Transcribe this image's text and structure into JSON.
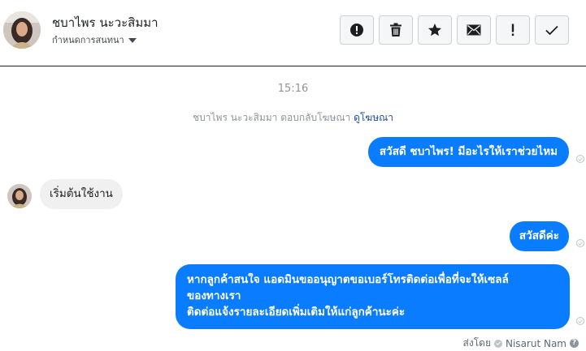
{
  "header": {
    "contact_name": "ชบาไพร นะวะสิมมา",
    "subtitle": "กำหนดการสนทนา",
    "actions": [
      {
        "icon": "alert-circle-icon",
        "label": "report"
      },
      {
        "icon": "trash-icon",
        "label": "delete"
      },
      {
        "icon": "star-icon",
        "label": "star"
      },
      {
        "icon": "envelope-icon",
        "label": "mark unread"
      },
      {
        "icon": "exclamation-icon",
        "label": "spam"
      },
      {
        "icon": "checkmark-icon",
        "label": "done"
      }
    ]
  },
  "conversation": {
    "timestamp": "15:16",
    "system_message": "ชบาไพร นะวะสิมมา ตอบกลับโฆษณา",
    "system_link": "ดูโฆษณา",
    "messages": [
      {
        "direction": "outgoing",
        "lines": [
          "สวัสดี ชบาไพร! มีอะไรให้เราช่วยไหม"
        ]
      },
      {
        "direction": "incoming",
        "lines": [
          "เริ่มต้นใช้งาน"
        ]
      },
      {
        "direction": "outgoing",
        "lines": [
          "สวัสดีค่ะ"
        ]
      },
      {
        "direction": "outgoing",
        "lines": [
          "หากลูกค้าสนใจ แอดมินขออนุญาตขอเบอร์โทรติดต่อเพื่อที่จะให้เซลล์",
          "ของทางเรา",
          "ติดต่อแจ้งรายละเอียดเพิ่มเติมให้แก่ลูกค้านะค่ะ"
        ]
      }
    ],
    "sent_by_label": "ส่งโดย",
    "sent_by_name": "Nisarut Nam"
  },
  "colors": {
    "outgoing_bubble": "#0a7cff",
    "incoming_bubble": "#f1f0f0",
    "link": "#1c4f9c"
  }
}
